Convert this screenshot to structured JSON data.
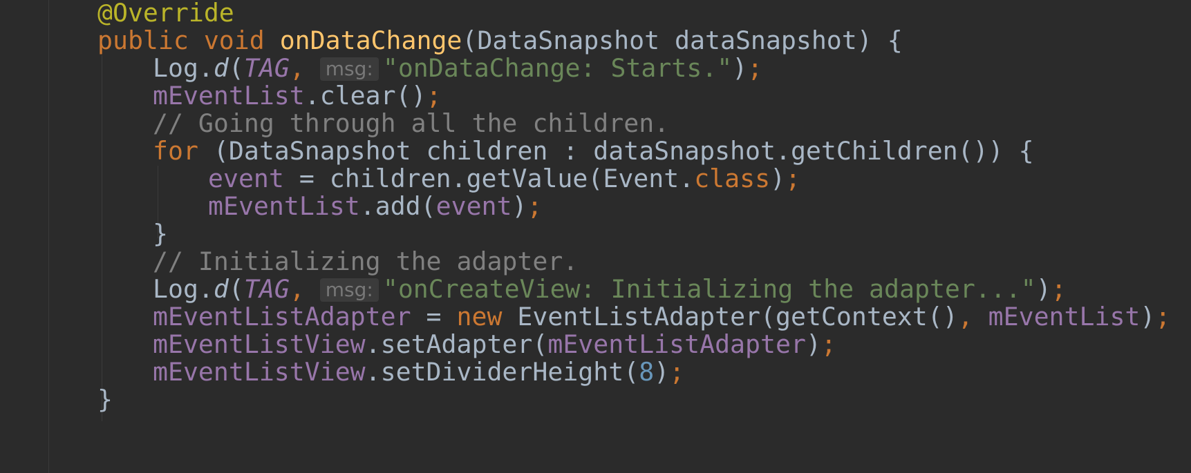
{
  "editor": {
    "theme_colors": {
      "background": "#2b2b2b",
      "annotation": "#bbb529",
      "keyword": "#cc7832",
      "method_decl": "#ffc66d",
      "field": "#9876aa",
      "string": "#6a8759",
      "comment": "#808080",
      "number": "#6897bb",
      "default": "#a9b7c6"
    },
    "lines": {
      "l1": {
        "ann": "@Override"
      },
      "l2": {
        "kw1": "public void ",
        "fn": "onDataChange",
        "rest": "(DataSnapshot dataSnapshot) {"
      },
      "l3": {
        "a": "Log.",
        "b": "d",
        "c": "(",
        "d": "TAG",
        "e": ", ",
        "hint": "msg:",
        "str": "\"onDataChange: Starts.\"",
        "f": ")",
        "g": ";"
      },
      "l4": {
        "a": "mEventList",
        "b": ".clear()",
        "c": ";"
      },
      "l5": {
        "cmt": "// Going through all the children."
      },
      "l6": {
        "kw": "for ",
        "rest": "(DataSnapshot children : dataSnapshot.getChildren()) {"
      },
      "l7": {
        "a": "event",
        "b": " = children.getValue(Event.",
        "c": "class",
        "d": ")",
        "e": ";"
      },
      "l8": {
        "a": "mEventList",
        "b": ".add(",
        "c": "event",
        "d": ")",
        "e": ";"
      },
      "l9": {
        "a": "}"
      },
      "l10": {
        "cmt": "// Initializing the adapter."
      },
      "l11": {
        "a": "Log.",
        "b": "d",
        "c": "(",
        "d": "TAG",
        "e": ", ",
        "hint": "msg:",
        "str": "\"onCreateView: Initializing the adapter...\"",
        "f": ")",
        "g": ";"
      },
      "l12": {
        "a": "mEventListAdapter",
        "b": " = ",
        "kw": "new ",
        "c": "EventListAdapter(getContext()",
        "d": ", ",
        "e": "mEventList",
        "f": ")",
        "g": ";"
      },
      "l13": {
        "a": "mEventListView",
        "b": ".setAdapter(",
        "c": "mEventListAdapter",
        "d": ")",
        "e": ";"
      },
      "l14": {
        "a": "mEventListView",
        "b": ".setDividerHeight(",
        "num": "8",
        "d": ")",
        "e": ";"
      },
      "l15": {
        "a": "}"
      }
    }
  }
}
